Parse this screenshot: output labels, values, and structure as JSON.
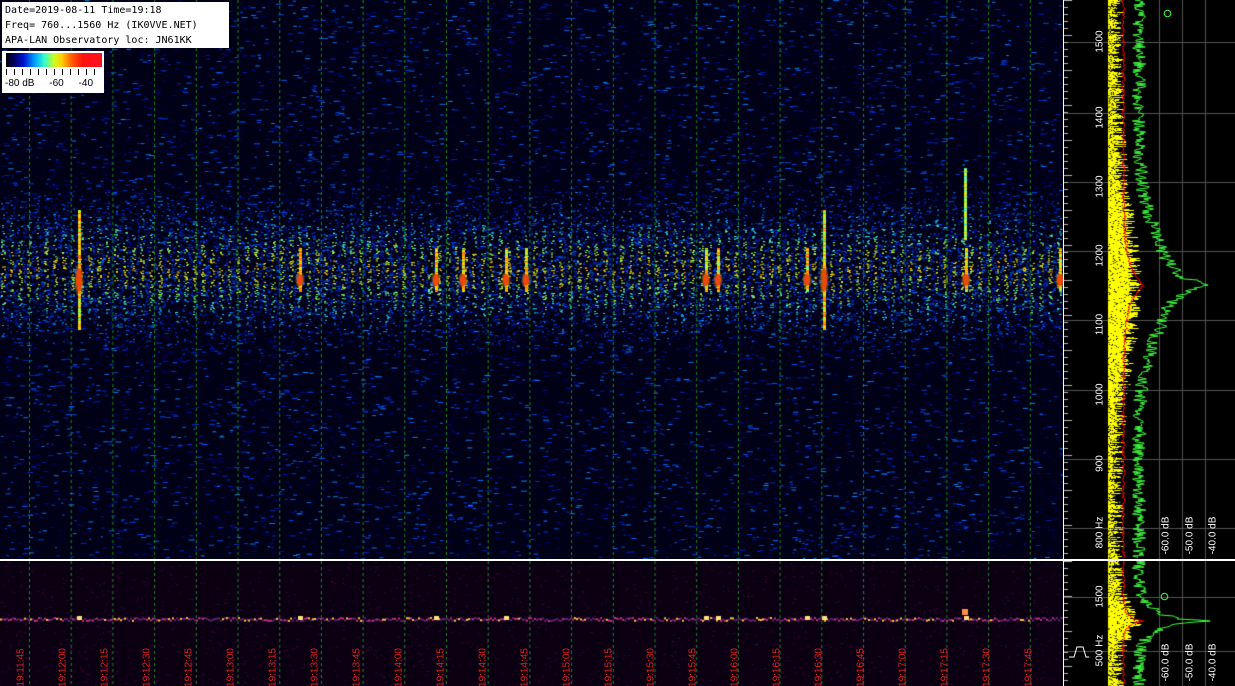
{
  "header": {
    "line1": "Date=2019-08-11 Time=19:18",
    "line2": "Freq= 760...1560 Hz (IK0VVE.NET)",
    "line3": "APA-LAN Observatory loc: JN61KK"
  },
  "color_scale": {
    "labels": [
      "-80 dB",
      "-60",
      "-40"
    ]
  },
  "freq_axis": {
    "labels": [
      "1500",
      "1400",
      "1300",
      "1200",
      "1100",
      "1000",
      "900",
      "800 Hz"
    ]
  },
  "lower_freq_axis": {
    "labels": [
      "1500",
      "500 Hz"
    ]
  },
  "time_axis": {
    "labels": [
      "19:11:45",
      "19:12:00",
      "19:12:15",
      "19:12:30",
      "19:12:45",
      "19:13:00",
      "19:13:15",
      "19:13:30",
      "19:13:45",
      "19:14:00",
      "19:14:15",
      "19:14:30",
      "19:14:45",
      "19:15:00",
      "19:15:15",
      "19:15:30",
      "19:15:45",
      "19:16:00",
      "19:16:15",
      "19:16:30",
      "19:16:45",
      "19:17:00",
      "19:17:15",
      "19:17:30",
      "19:17:45"
    ]
  },
  "spectrum_axis": {
    "labels": [
      "-60.0 dB",
      "-50.0 dB",
      "-40.0 dB"
    ]
  },
  "lower_spectrum_axis": {
    "labels": [
      "-60.0 dB",
      "-50.0 dB",
      "-40.0 dB"
    ]
  },
  "colors": {
    "grid_green": "#1e8a1e",
    "time_red": "#e02020",
    "spectrum_yellow": "#ffff00",
    "spectrum_green": "#40ff40",
    "spectrum_red": "#ff0000"
  },
  "icons": [
    "marker-circle-icon",
    "marker-circle-icon",
    "waveform-icon"
  ]
}
